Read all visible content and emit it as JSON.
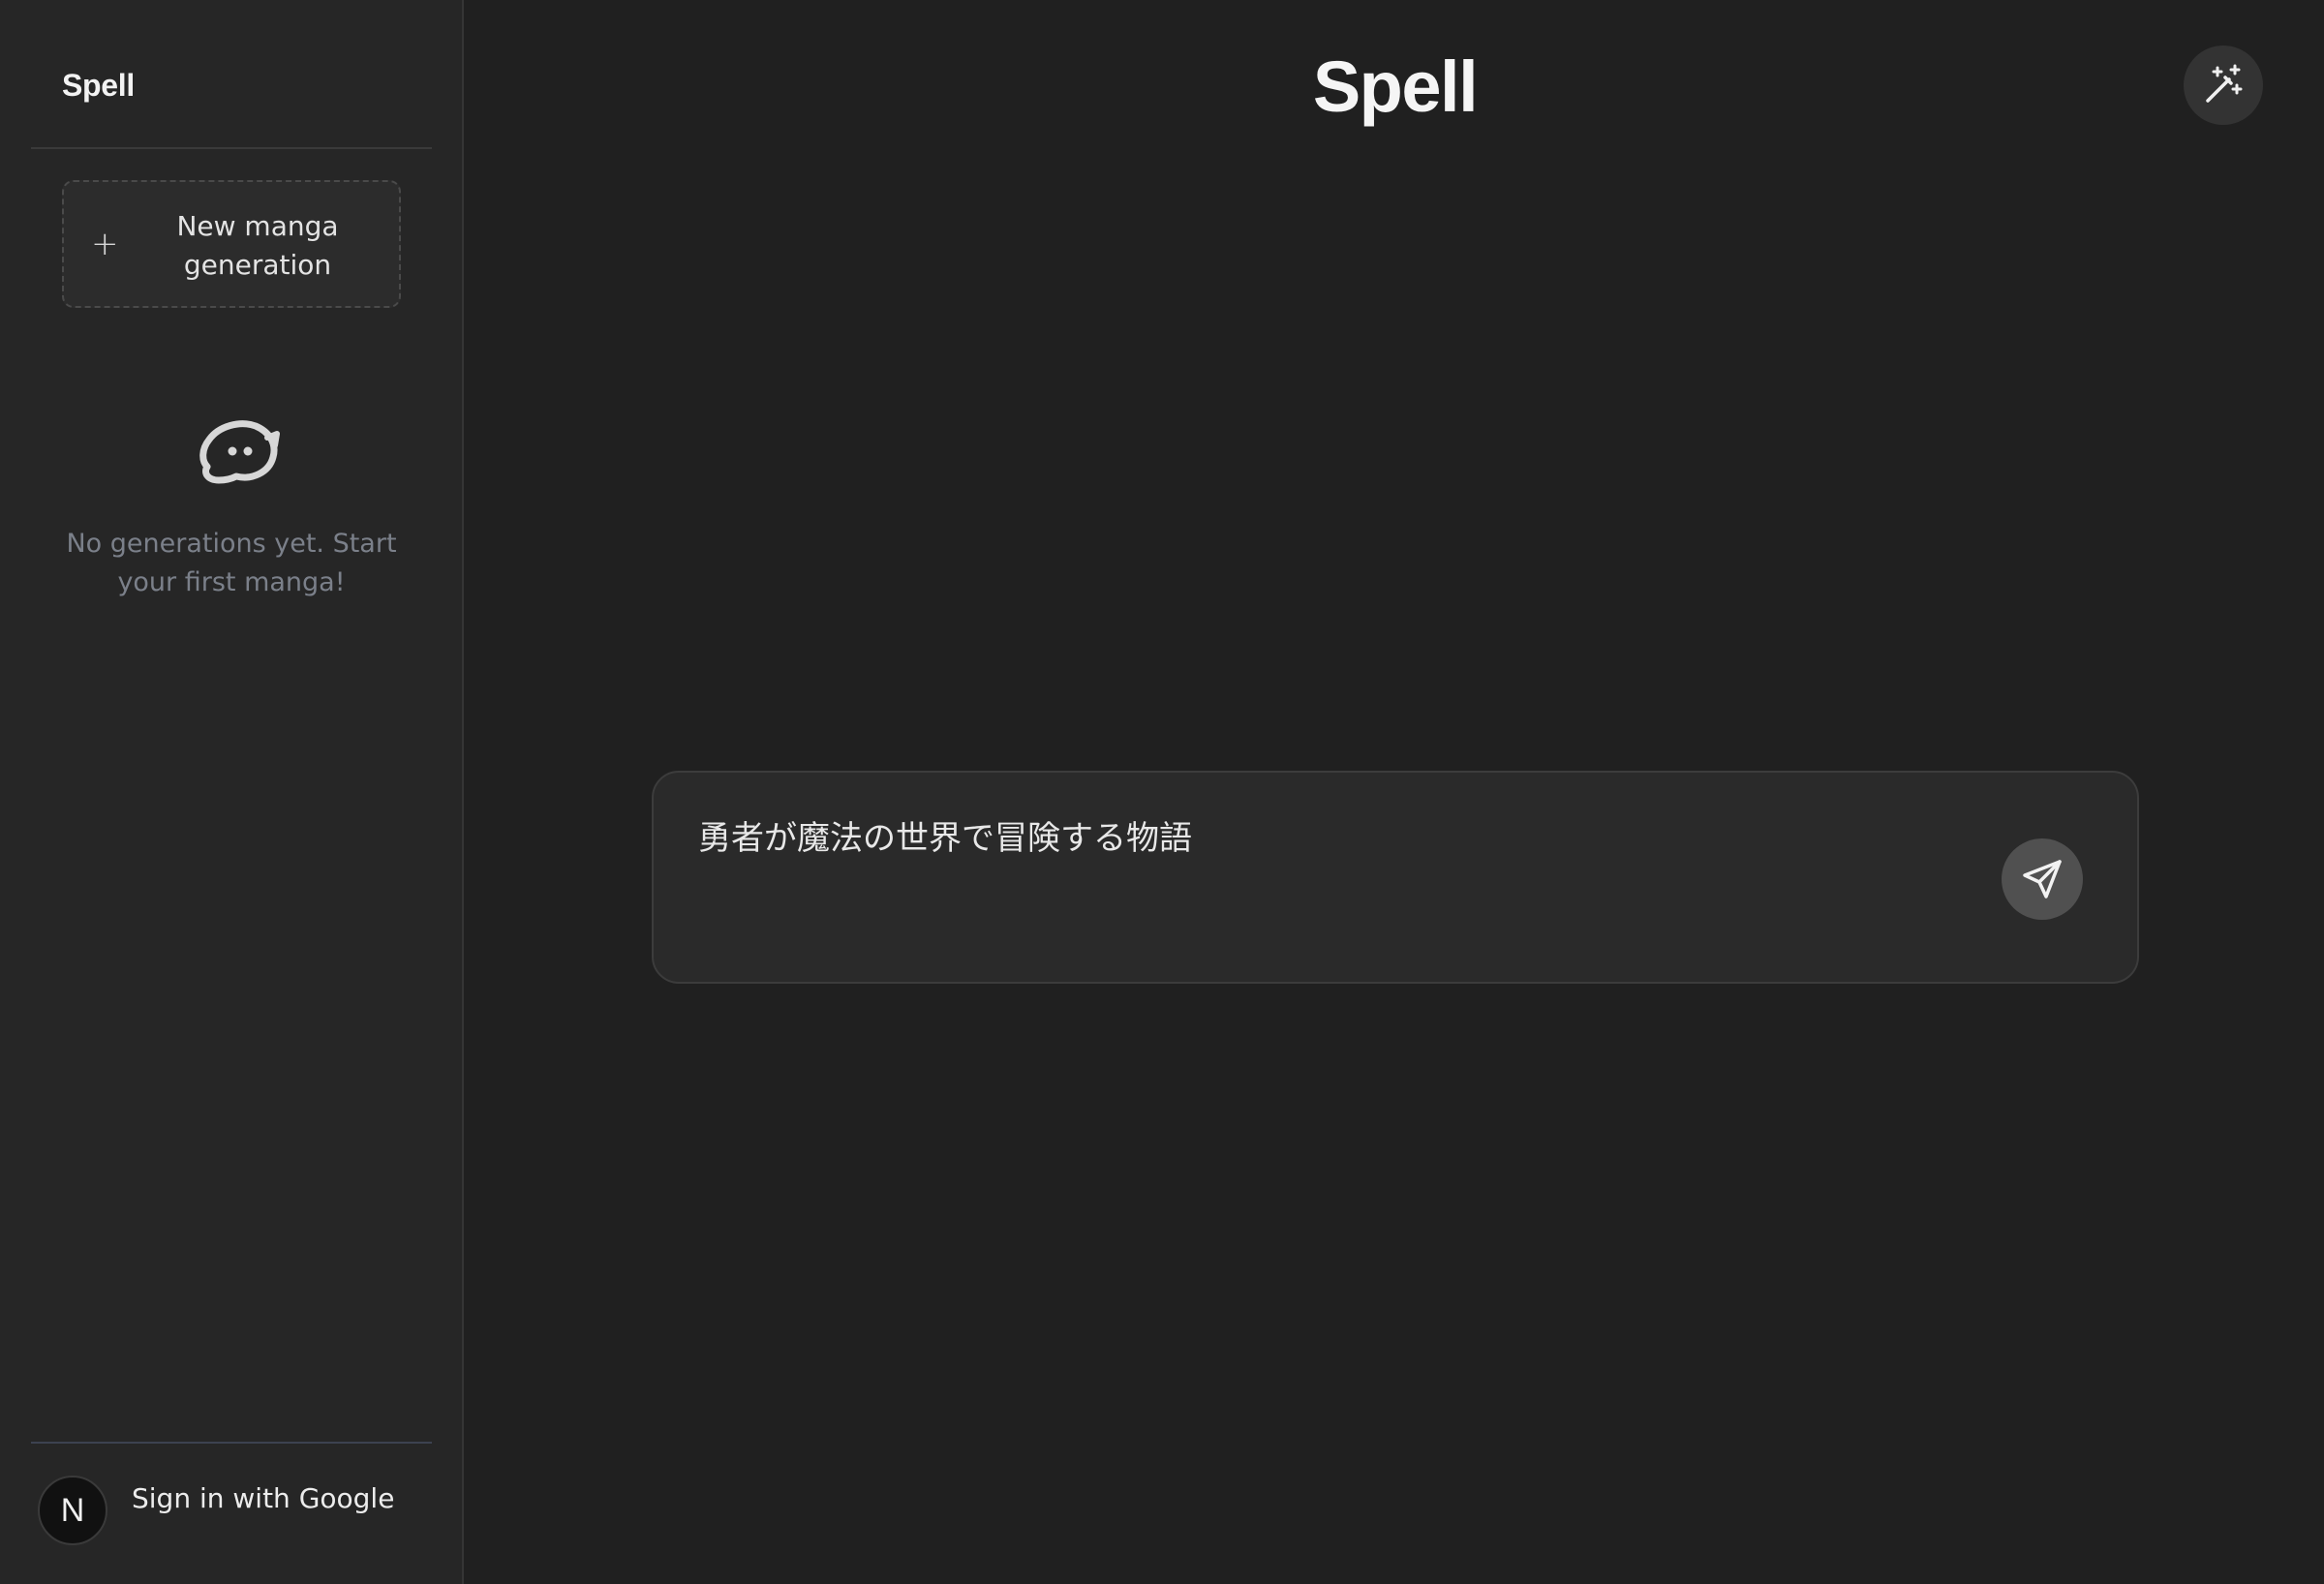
{
  "sidebar": {
    "title": "Spell",
    "new_generation_label": "New manga generation",
    "new_generation_icon": "plus-icon",
    "empty_state": {
      "icon": "chat-bubble-icon",
      "text": "No generations yet. Start your first manga!"
    },
    "user": {
      "avatar_letter": "N",
      "sign_in_label": "Sign in with Google"
    }
  },
  "main": {
    "title": "Spell",
    "magic_button_icon": "magic-wand-icon",
    "prompt": {
      "value": "勇者が魔法の世界で冒険する物語",
      "send_icon": "send-icon"
    }
  },
  "colors": {
    "background": "#202020",
    "sidebar_background": "#262626",
    "prompt_background": "#2a2a2a",
    "send_button": "#505050",
    "muted_text": "#7b808a"
  }
}
